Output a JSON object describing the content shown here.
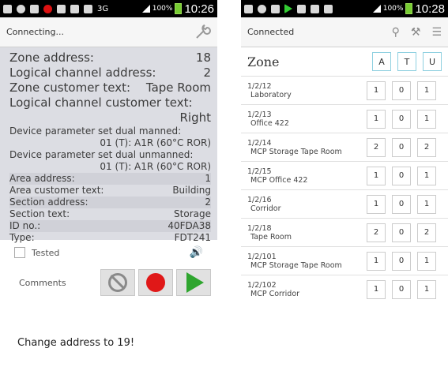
{
  "left": {
    "status": {
      "percent": "100%",
      "time": "10:26",
      "network": "3G"
    },
    "title": "Connecting...",
    "rows": [
      {
        "label": "Zone address:",
        "value": "18",
        "size": "big"
      },
      {
        "label": "Logical channel address:",
        "value": "2",
        "size": "big"
      },
      {
        "label": "Zone customer text:",
        "value": "Tape Room",
        "size": "big"
      },
      {
        "label": "Logical channel customer text:",
        "value": "",
        "size": "big"
      },
      {
        "label": "",
        "value": "Right",
        "size": "big"
      },
      {
        "label": "Device parameter set dual manned:",
        "value": "",
        "size": "small"
      },
      {
        "label": "",
        "value": "01 (T): A1R (60°C ROR)",
        "size": "small"
      },
      {
        "label": "Device parameter set dual unmanned:",
        "value": "",
        "size": "small"
      },
      {
        "label": "",
        "value": "01 (T): A1R (60°C ROR)",
        "size": "small"
      },
      {
        "label": "Area address:",
        "value": "1",
        "size": "small"
      },
      {
        "label": "Area customer text:",
        "value": "Building",
        "size": "small"
      },
      {
        "label": "Section address:",
        "value": "2",
        "size": "small"
      },
      {
        "label": "Section text:",
        "value": "Storage",
        "size": "small"
      },
      {
        "label": "ID no.:",
        "value": "40FDA38",
        "size": "small"
      },
      {
        "label": "Type:",
        "value": "FDT241",
        "size": "small"
      }
    ],
    "tested_label": "Tested",
    "comments_label": "Comments",
    "note": "Change address to 19!"
  },
  "right": {
    "status": {
      "percent": "100%",
      "time": "10:28"
    },
    "title": "Connected",
    "zone_header": "Zone",
    "columns": [
      "A",
      "T",
      "U"
    ],
    "zones": [
      {
        "id": "1/2/12",
        "name": "Laboratory",
        "a": "1",
        "t": "0",
        "u": "1"
      },
      {
        "id": "1/2/13",
        "name": "Office 422",
        "a": "1",
        "t": "0",
        "u": "1"
      },
      {
        "id": "1/2/14",
        "name": "MCP Storage Tape Room",
        "a": "2",
        "t": "0",
        "u": "2"
      },
      {
        "id": "1/2/15",
        "name": "MCP Office 422",
        "a": "1",
        "t": "0",
        "u": "1"
      },
      {
        "id": "1/2/16",
        "name": "Corridor",
        "a": "1",
        "t": "0",
        "u": "1"
      },
      {
        "id": "1/2/18",
        "name": "Tape Room",
        "a": "2",
        "t": "0",
        "u": "2"
      },
      {
        "id": "1/2/101",
        "name": "MCP Storage Tape Room",
        "a": "1",
        "t": "0",
        "u": "1"
      },
      {
        "id": "1/2/102",
        "name": "MCP Corridor",
        "a": "1",
        "t": "0",
        "u": "1"
      }
    ]
  }
}
